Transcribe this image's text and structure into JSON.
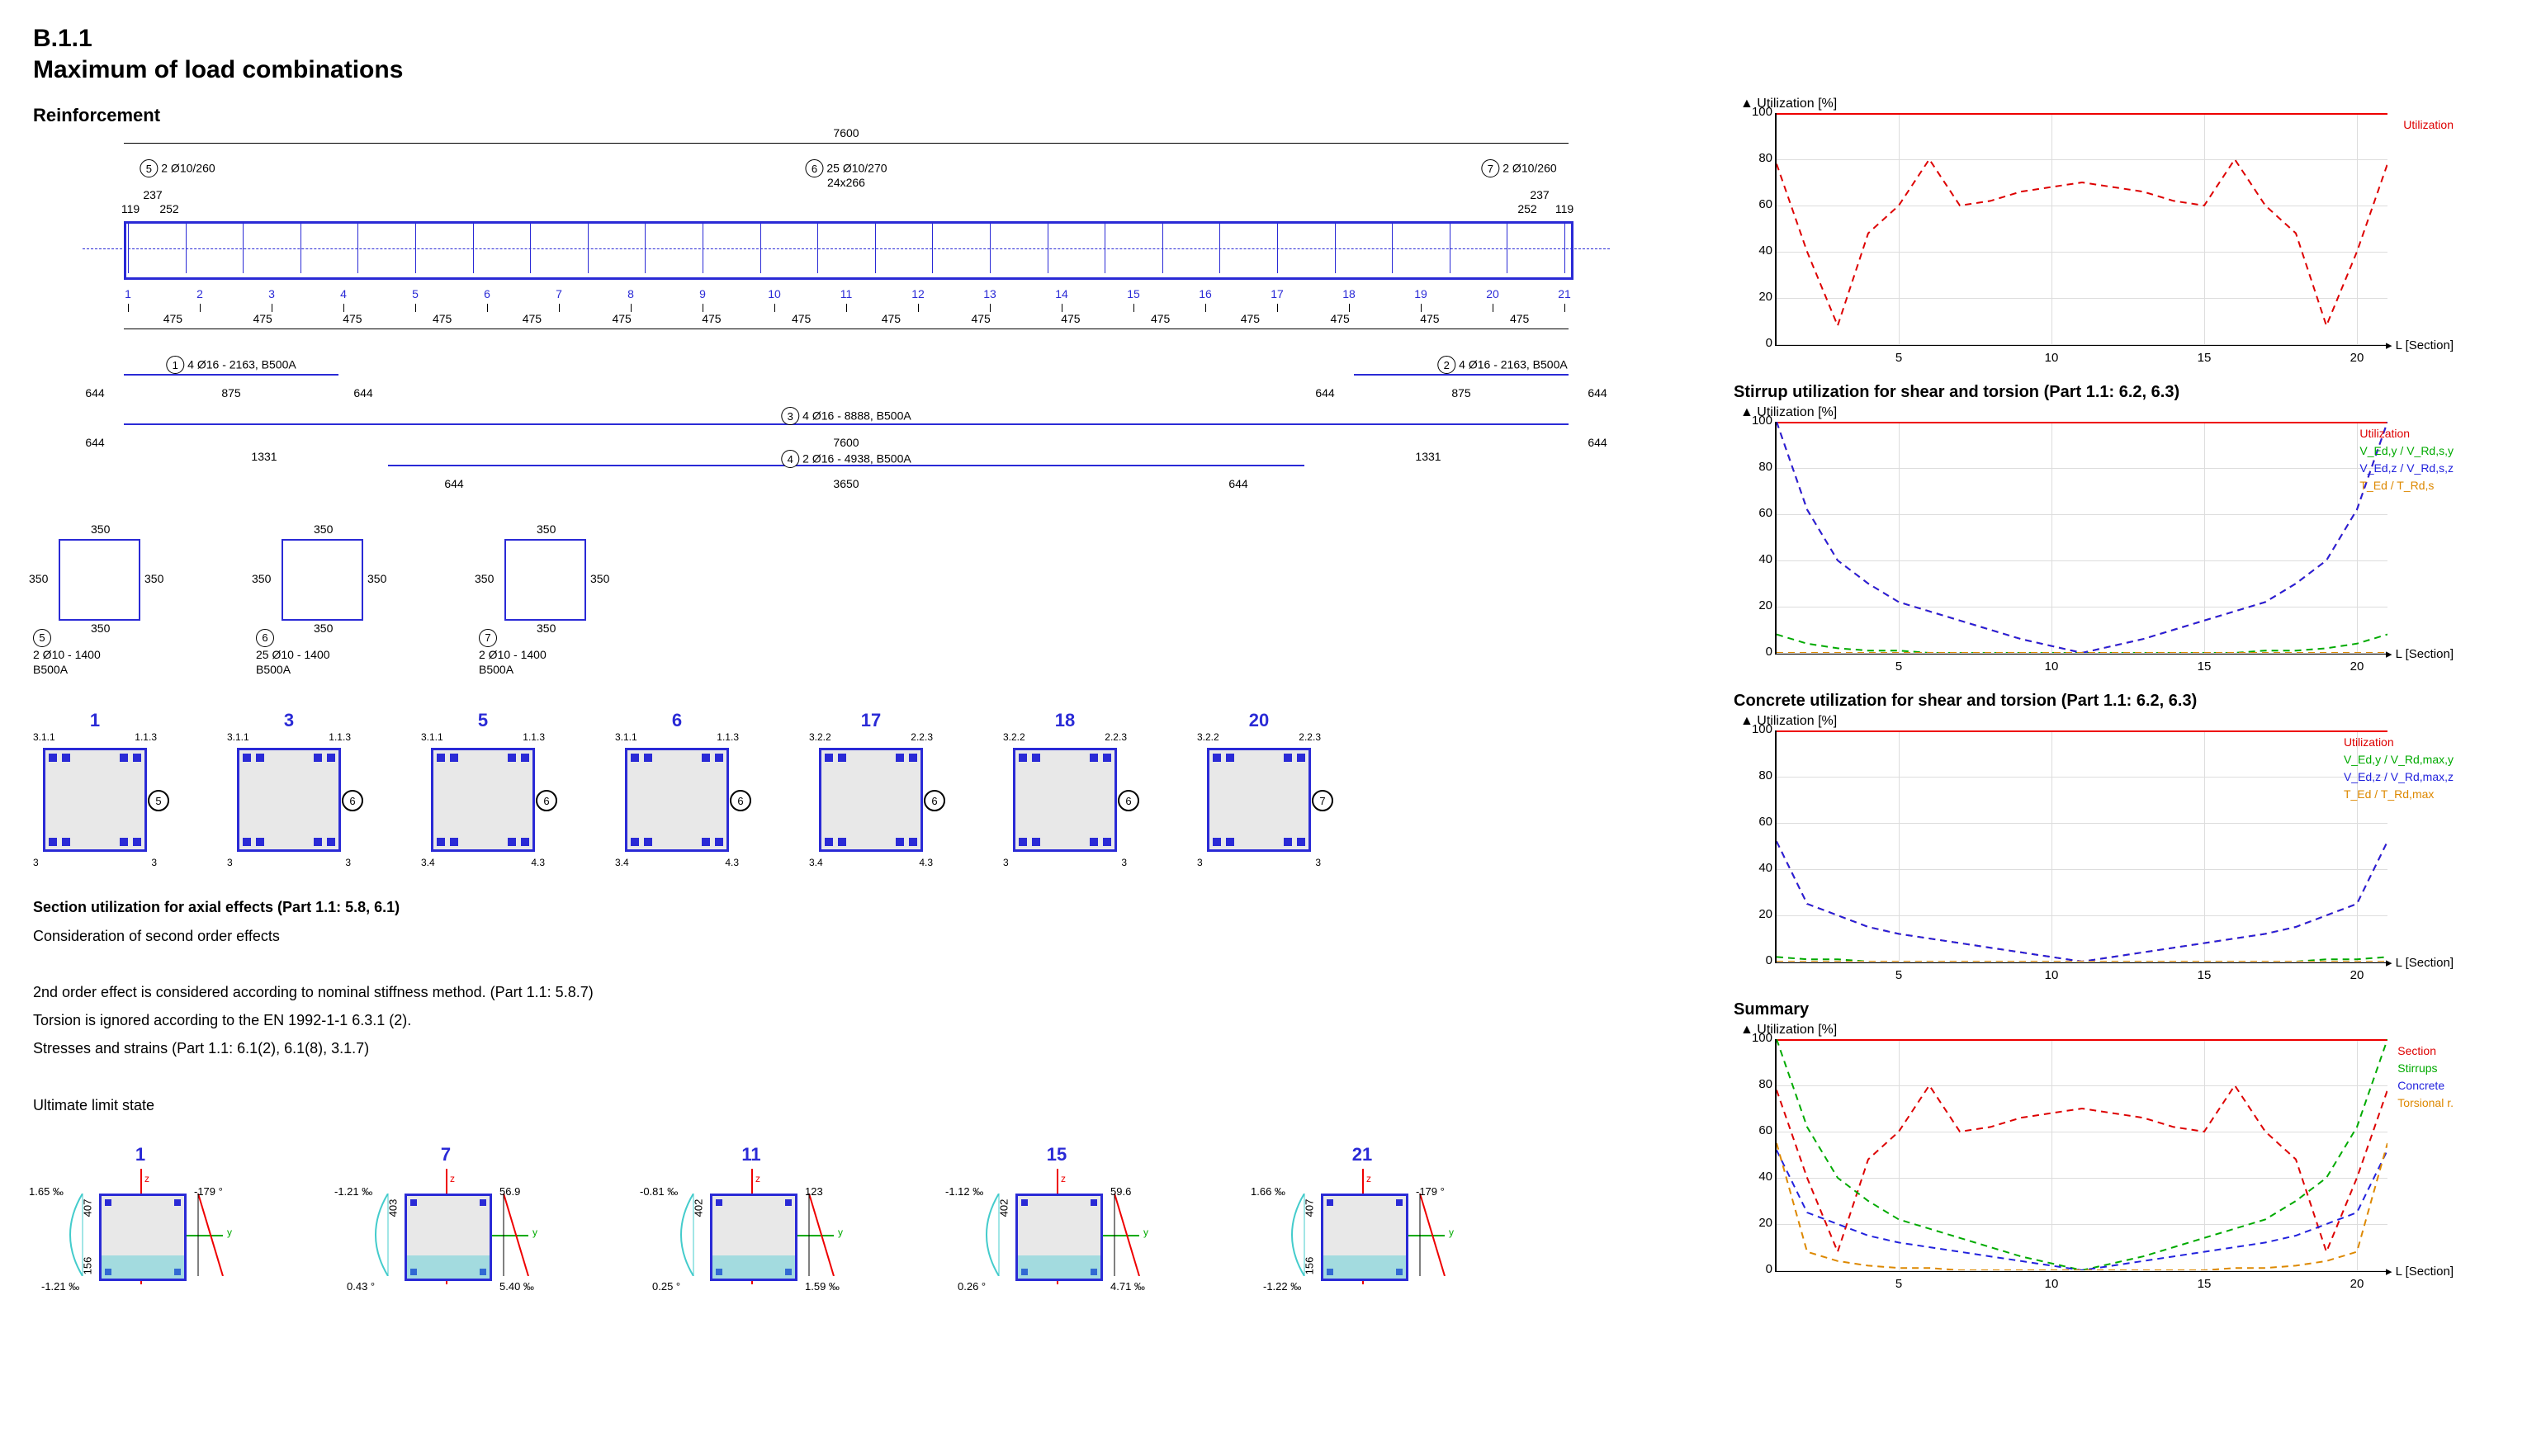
{
  "section_number": "B.1.1",
  "section_title": "Maximum of load combinations",
  "reinforcement_heading": "Reinforcement",
  "top_dimension_total": "7600",
  "stirrup_zones": {
    "left": {
      "tag": "5",
      "label": "2 Ø10/260",
      "ext": "119",
      "int": "252",
      "off": "237"
    },
    "mid": {
      "tag": "6",
      "label": "25 Ø10/270",
      "sub": "24x266"
    },
    "right": {
      "tag": "7",
      "label": "2 Ø10/260",
      "ext": "119",
      "int": "252",
      "off": "237"
    }
  },
  "section_positions": [
    "1",
    "2",
    "3",
    "4",
    "5",
    "6",
    "7",
    "8",
    "9",
    "10",
    "11",
    "12",
    "13",
    "14",
    "15",
    "16",
    "17",
    "18",
    "19",
    "20",
    "21"
  ],
  "bottom_spacings": [
    "475",
    "475",
    "475",
    "475",
    "475",
    "475",
    "475",
    "475",
    "475",
    "475",
    "475",
    "475",
    "475",
    "475",
    "475",
    "475"
  ],
  "rebars": [
    {
      "tag": "1",
      "label": "4 Ø16 - 2163, B500A",
      "center": "875",
      "ext_l": "644",
      "ext_r": "644"
    },
    {
      "tag": "2",
      "label": "4 Ø16 - 2163, B500A",
      "center": "875",
      "ext_l": "644",
      "ext_r": "644"
    },
    {
      "tag": "3",
      "label": "4 Ø16 - 8888, B500A",
      "center": "7600",
      "ext_l": "644",
      "ext_r": "644"
    },
    {
      "tag": "4",
      "label": "2 Ø16 - 4938, B500A",
      "center": "3650",
      "off_l": "1331",
      "off_r": "1331",
      "ext_l": "644",
      "ext_r": "644"
    }
  ],
  "stirrup_sections": [
    {
      "dim": "350",
      "tag": "5",
      "caption_line1": "2 Ø10 - 1400",
      "caption_line2": "B500A"
    },
    {
      "dim": "350",
      "tag": "6",
      "caption_line1": "25 Ø10 - 1400",
      "caption_line2": "B500A"
    },
    {
      "dim": "350",
      "tag": "7",
      "caption_line1": "2 Ø10 - 1400",
      "caption_line2": "B500A"
    }
  ],
  "cross_sections": [
    {
      "title": "1",
      "top_dims": [
        "3.1.1",
        "1.1.3"
      ],
      "bot_dims": [
        "3",
        "3"
      ],
      "tag": "5"
    },
    {
      "title": "3",
      "top_dims": [
        "3.1.1",
        "1.1.3"
      ],
      "bot_dims": [
        "3",
        "3"
      ],
      "tag": "6"
    },
    {
      "title": "5",
      "top_dims": [
        "3.1.1",
        "1.1.3"
      ],
      "bot_dims": [
        "3.4",
        "4.3"
      ],
      "tag": "6"
    },
    {
      "title": "6",
      "top_dims": [
        "3.1.1",
        "1.1.3"
      ],
      "bot_dims": [
        "3.4",
        "4.3"
      ],
      "tag": "6"
    },
    {
      "title": "17",
      "top_dims": [
        "3.2.2",
        "2.2.3"
      ],
      "bot_dims": [
        "3.4",
        "4.3"
      ],
      "tag": "6"
    },
    {
      "title": "18",
      "top_dims": [
        "3.2.2",
        "2.2.3"
      ],
      "bot_dims": [
        "3",
        "3"
      ],
      "tag": "6"
    },
    {
      "title": "20",
      "top_dims": [
        "3.2.2",
        "2.2.3"
      ],
      "bot_dims": [
        "3",
        "3"
      ],
      "tag": "7"
    }
  ],
  "util_axial_heading": "Section utilization for axial effects (Part 1.1: 5.8, 6.1)",
  "util_axial_sub": "Consideration of second order effects",
  "note_second_order": "2nd order effect is considered according to nominal stiffness method. (Part 1.1: 5.8.7)",
  "note_torsion": "Torsion is ignored according to the EN 1992-1-1 6.3.1 (2).",
  "note_stresses": "Stresses and strains (Part 1.1: 6.1(2), 6.1(8), 3.1.7)",
  "note_uls": "Ultimate limit state",
  "strain_diagrams": [
    {
      "sec": "1",
      "h": "407",
      "d": "156",
      "top": "1.65 ‰",
      "bot": "-1.21 ‰",
      "right_top": "-179 °",
      "right_bot": ""
    },
    {
      "sec": "7",
      "h": "403",
      "d": "",
      "top": "-1.21 ‰",
      "bot": "0.43 °",
      "right_top": "56.9",
      "right_bot": "5.40 ‰"
    },
    {
      "sec": "11",
      "h": "402",
      "d": "",
      "top": "-0.81 ‰",
      "bot": "0.25 °",
      "right_top": "123",
      "right_bot": "1.59 ‰"
    },
    {
      "sec": "15",
      "h": "402",
      "d": "",
      "top": "-1.12 ‰",
      "bot": "0.26 °",
      "right_top": "59.6",
      "right_bot": "4.71 ‰"
    },
    {
      "sec": "21",
      "h": "407",
      "d": "156",
      "top": "1.66 ‰",
      "bot": "-1.22 ‰",
      "right_top": "-179 °",
      "right_bot": ""
    }
  ],
  "chart_labels": {
    "y_title": "Utilization [%]",
    "x_title": "L [Section]",
    "legend_util": "Utilization"
  },
  "x_ticks": [
    5,
    10,
    15,
    20
  ],
  "y_ticks": [
    0,
    20,
    40,
    60,
    80,
    100
  ],
  "chart_data": [
    {
      "id": "section",
      "title": "",
      "type": "line",
      "ylim": [
        0,
        100
      ],
      "xlim": [
        1,
        21
      ],
      "ylabel": "Utilization [%]",
      "xlabel": "L [Section]",
      "legend": [
        "Utilization"
      ],
      "x": [
        1,
        2,
        3,
        4,
        5,
        6,
        7,
        8,
        9,
        10,
        11,
        12,
        13,
        14,
        15,
        16,
        17,
        18,
        19,
        20,
        21
      ],
      "series": [
        {
          "name": "Utilization",
          "values": [
            78,
            40,
            8,
            48,
            60,
            80,
            60,
            62,
            66,
            68,
            70,
            68,
            66,
            62,
            60,
            80,
            60,
            48,
            8,
            40,
            78
          ]
        }
      ]
    },
    {
      "id": "stirrup",
      "title": "Stirrup utilization for shear and torsion (Part 1.1: 6.2, 6.3)",
      "type": "line",
      "ylim": [
        0,
        100
      ],
      "xlim": [
        1,
        21
      ],
      "ylabel": "Utilization [%]",
      "xlabel": "L [Section]",
      "legend": [
        "Utilization",
        "V_Ed,y / V_Rd,s,y",
        "V_Ed,z / V_Rd,s,z",
        "T_Ed / T_Rd,s"
      ],
      "x": [
        1,
        2,
        3,
        4,
        5,
        6,
        7,
        8,
        9,
        10,
        11,
        12,
        13,
        14,
        15,
        16,
        17,
        18,
        19,
        20,
        21
      ],
      "series": [
        {
          "name": "Utilization",
          "values": [
            100,
            62,
            40,
            30,
            22,
            18,
            14,
            10,
            6,
            3,
            0,
            3,
            6,
            10,
            14,
            18,
            22,
            30,
            40,
            62,
            100
          ]
        },
        {
          "name": "VEd,y/VRd,s,y",
          "values": [
            8,
            4,
            2,
            1,
            1,
            0,
            0,
            0,
            0,
            0,
            0,
            0,
            0,
            0,
            0,
            0,
            1,
            1,
            2,
            4,
            8
          ]
        },
        {
          "name": "VEd,z/VRd,s,z",
          "values": [
            100,
            62,
            40,
            30,
            22,
            18,
            14,
            10,
            6,
            3,
            0,
            3,
            6,
            10,
            14,
            18,
            22,
            30,
            40,
            62,
            100
          ]
        },
        {
          "name": "TEd/TRd,s",
          "values": [
            0,
            0,
            0,
            0,
            0,
            0,
            0,
            0,
            0,
            0,
            0,
            0,
            0,
            0,
            0,
            0,
            0,
            0,
            0,
            0,
            0
          ]
        }
      ]
    },
    {
      "id": "concrete",
      "title": "Concrete utilization for shear and torsion (Part 1.1: 6.2, 6.3)",
      "type": "line",
      "ylim": [
        0,
        100
      ],
      "xlim": [
        1,
        21
      ],
      "ylabel": "Utilization [%]",
      "xlabel": "L [Section]",
      "legend": [
        "Utilization",
        "V_Ed,y / V_Rd,max,y",
        "V_Ed,z / V_Rd,max,z",
        "T_Ed / T_Rd,max"
      ],
      "x": [
        1,
        2,
        3,
        4,
        5,
        6,
        7,
        8,
        9,
        10,
        11,
        12,
        13,
        14,
        15,
        16,
        17,
        18,
        19,
        20,
        21
      ],
      "series": [
        {
          "name": "Utilization",
          "values": [
            52,
            25,
            20,
            15,
            12,
            10,
            8,
            6,
            4,
            2,
            0,
            2,
            4,
            6,
            8,
            10,
            12,
            15,
            20,
            25,
            52
          ]
        },
        {
          "name": "VEd,y/VRd,max,y",
          "values": [
            2,
            1,
            1,
            0,
            0,
            0,
            0,
            0,
            0,
            0,
            0,
            0,
            0,
            0,
            0,
            0,
            0,
            0,
            1,
            1,
            2
          ]
        },
        {
          "name": "VEd,z/VRd,max,z",
          "values": [
            52,
            25,
            20,
            15,
            12,
            10,
            8,
            6,
            4,
            2,
            0,
            2,
            4,
            6,
            8,
            10,
            12,
            15,
            20,
            25,
            52
          ]
        },
        {
          "name": "TEd/TRd,max",
          "values": [
            0,
            0,
            0,
            0,
            0,
            0,
            0,
            0,
            0,
            0,
            0,
            0,
            0,
            0,
            0,
            0,
            0,
            0,
            0,
            0,
            0
          ]
        }
      ]
    },
    {
      "id": "summary",
      "title": "Summary",
      "type": "line",
      "ylim": [
        0,
        100
      ],
      "xlim": [
        1,
        21
      ],
      "ylabel": "Utilization [%]",
      "xlabel": "L [Section]",
      "legend": [
        "Section",
        "Stirrups",
        "Concrete",
        "Torsional r."
      ],
      "x": [
        1,
        2,
        3,
        4,
        5,
        6,
        7,
        8,
        9,
        10,
        11,
        12,
        13,
        14,
        15,
        16,
        17,
        18,
        19,
        20,
        21
      ],
      "series": [
        {
          "name": "Section",
          "values": [
            78,
            40,
            8,
            48,
            60,
            80,
            60,
            62,
            66,
            68,
            70,
            68,
            66,
            62,
            60,
            80,
            60,
            48,
            8,
            40,
            78
          ]
        },
        {
          "name": "Stirrups",
          "values": [
            100,
            62,
            40,
            30,
            22,
            18,
            14,
            10,
            6,
            3,
            0,
            3,
            6,
            10,
            14,
            18,
            22,
            30,
            40,
            62,
            100
          ]
        },
        {
          "name": "Concrete",
          "values": [
            52,
            25,
            20,
            15,
            12,
            10,
            8,
            6,
            4,
            2,
            0,
            2,
            4,
            6,
            8,
            10,
            12,
            15,
            20,
            25,
            52
          ]
        },
        {
          "name": "Torsional r.",
          "values": [
            55,
            8,
            4,
            2,
            1,
            1,
            0,
            0,
            0,
            0,
            0,
            0,
            0,
            0,
            0,
            1,
            1,
            2,
            4,
            8,
            55
          ]
        }
      ]
    }
  ]
}
